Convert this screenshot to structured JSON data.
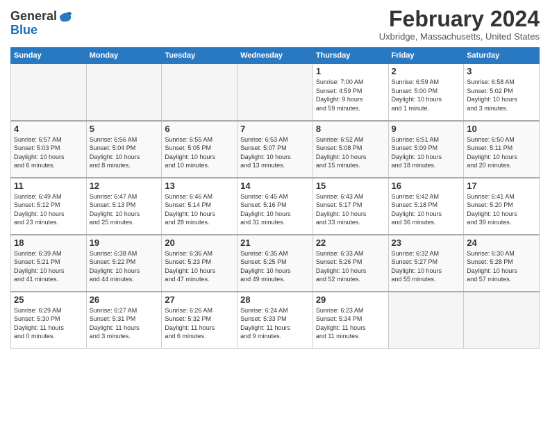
{
  "header": {
    "logo_line1": "General",
    "logo_line2": "Blue",
    "title": "February 2024",
    "subtitle": "Uxbridge, Massachusetts, United States"
  },
  "columns": [
    "Sunday",
    "Monday",
    "Tuesday",
    "Wednesday",
    "Thursday",
    "Friday",
    "Saturday"
  ],
  "weeks": [
    [
      {
        "day": "",
        "info": ""
      },
      {
        "day": "",
        "info": ""
      },
      {
        "day": "",
        "info": ""
      },
      {
        "day": "",
        "info": ""
      },
      {
        "day": "1",
        "info": "Sunrise: 7:00 AM\nSunset: 4:59 PM\nDaylight: 9 hours\nand 59 minutes."
      },
      {
        "day": "2",
        "info": "Sunrise: 6:59 AM\nSunset: 5:00 PM\nDaylight: 10 hours\nand 1 minute."
      },
      {
        "day": "3",
        "info": "Sunrise: 6:58 AM\nSunset: 5:02 PM\nDaylight: 10 hours\nand 3 minutes."
      }
    ],
    [
      {
        "day": "4",
        "info": "Sunrise: 6:57 AM\nSunset: 5:03 PM\nDaylight: 10 hours\nand 6 minutes."
      },
      {
        "day": "5",
        "info": "Sunrise: 6:56 AM\nSunset: 5:04 PM\nDaylight: 10 hours\nand 8 minutes."
      },
      {
        "day": "6",
        "info": "Sunrise: 6:55 AM\nSunset: 5:05 PM\nDaylight: 10 hours\nand 10 minutes."
      },
      {
        "day": "7",
        "info": "Sunrise: 6:53 AM\nSunset: 5:07 PM\nDaylight: 10 hours\nand 13 minutes."
      },
      {
        "day": "8",
        "info": "Sunrise: 6:52 AM\nSunset: 5:08 PM\nDaylight: 10 hours\nand 15 minutes."
      },
      {
        "day": "9",
        "info": "Sunrise: 6:51 AM\nSunset: 5:09 PM\nDaylight: 10 hours\nand 18 minutes."
      },
      {
        "day": "10",
        "info": "Sunrise: 6:50 AM\nSunset: 5:11 PM\nDaylight: 10 hours\nand 20 minutes."
      }
    ],
    [
      {
        "day": "11",
        "info": "Sunrise: 6:49 AM\nSunset: 5:12 PM\nDaylight: 10 hours\nand 23 minutes."
      },
      {
        "day": "12",
        "info": "Sunrise: 6:47 AM\nSunset: 5:13 PM\nDaylight: 10 hours\nand 25 minutes."
      },
      {
        "day": "13",
        "info": "Sunrise: 6:46 AM\nSunset: 5:14 PM\nDaylight: 10 hours\nand 28 minutes."
      },
      {
        "day": "14",
        "info": "Sunrise: 6:45 AM\nSunset: 5:16 PM\nDaylight: 10 hours\nand 31 minutes."
      },
      {
        "day": "15",
        "info": "Sunrise: 6:43 AM\nSunset: 5:17 PM\nDaylight: 10 hours\nand 33 minutes."
      },
      {
        "day": "16",
        "info": "Sunrise: 6:42 AM\nSunset: 5:18 PM\nDaylight: 10 hours\nand 36 minutes."
      },
      {
        "day": "17",
        "info": "Sunrise: 6:41 AM\nSunset: 5:20 PM\nDaylight: 10 hours\nand 39 minutes."
      }
    ],
    [
      {
        "day": "18",
        "info": "Sunrise: 6:39 AM\nSunset: 5:21 PM\nDaylight: 10 hours\nand 41 minutes."
      },
      {
        "day": "19",
        "info": "Sunrise: 6:38 AM\nSunset: 5:22 PM\nDaylight: 10 hours\nand 44 minutes."
      },
      {
        "day": "20",
        "info": "Sunrise: 6:36 AM\nSunset: 5:23 PM\nDaylight: 10 hours\nand 47 minutes."
      },
      {
        "day": "21",
        "info": "Sunrise: 6:35 AM\nSunset: 5:25 PM\nDaylight: 10 hours\nand 49 minutes."
      },
      {
        "day": "22",
        "info": "Sunrise: 6:33 AM\nSunset: 5:26 PM\nDaylight: 10 hours\nand 52 minutes."
      },
      {
        "day": "23",
        "info": "Sunrise: 6:32 AM\nSunset: 5:27 PM\nDaylight: 10 hours\nand 55 minutes."
      },
      {
        "day": "24",
        "info": "Sunrise: 6:30 AM\nSunset: 5:28 PM\nDaylight: 10 hours\nand 57 minutes."
      }
    ],
    [
      {
        "day": "25",
        "info": "Sunrise: 6:29 AM\nSunset: 5:30 PM\nDaylight: 11 hours\nand 0 minutes."
      },
      {
        "day": "26",
        "info": "Sunrise: 6:27 AM\nSunset: 5:31 PM\nDaylight: 11 hours\nand 3 minutes."
      },
      {
        "day": "27",
        "info": "Sunrise: 6:26 AM\nSunset: 5:32 PM\nDaylight: 11 hours\nand 6 minutes."
      },
      {
        "day": "28",
        "info": "Sunrise: 6:24 AM\nSunset: 5:33 PM\nDaylight: 11 hours\nand 9 minutes."
      },
      {
        "day": "29",
        "info": "Sunrise: 6:23 AM\nSunset: 5:34 PM\nDaylight: 11 hours\nand 11 minutes."
      },
      {
        "day": "",
        "info": ""
      },
      {
        "day": "",
        "info": ""
      }
    ]
  ]
}
